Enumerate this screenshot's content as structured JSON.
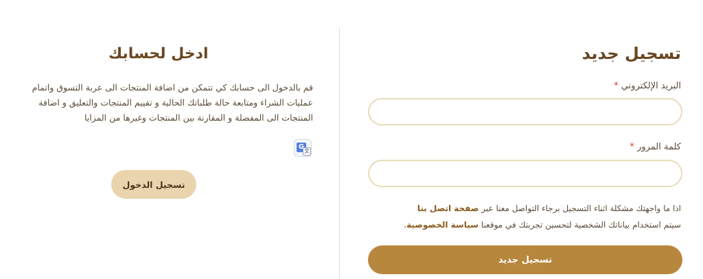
{
  "register": {
    "title": "تسجيل جديد",
    "email_label": "البريد الإلكتروني",
    "password_label": "كلمة المرور",
    "required_mark": "*",
    "email_value": "",
    "password_value": "",
    "note_line1_prefix": "اذا ما واجهتك مشكلة اثناء التسجيل برجاء التواصل معنا عبر",
    "note_line1_link": "صفحة اتصل بنا",
    "note_line2_prefix": "سيتم استخدام بياناتك الشخصية لتحسين تجربتك في موقعنا",
    "note_line2_link": "سياسة الخصوصية",
    "note_line2_suffix": ".",
    "button_label": "تسجيل جديد"
  },
  "login": {
    "title": "ادخل لحسابك",
    "description_lines": [
      "قم بالدخول الى حسابك كي تتمكن من اضافة المنتجات الى عربة التسوق واتمام",
      "عمليات الشراء ومتابعة حالة طلباتك الحالية و تقييم المنتجات والتعليق و اضافة",
      "المنتجات الى المفضلة و المقارنة بين المنتجات وغيرها من المزايا"
    ],
    "button_label": "تسجيل الدخول"
  },
  "icons": {
    "translate": "google-translate-icon"
  },
  "colors": {
    "accent": "#b7873e",
    "title": "#6a4622",
    "input_border": "#e8dcb7",
    "login_button": "#e9d4ad",
    "required": "#d43b2b"
  }
}
